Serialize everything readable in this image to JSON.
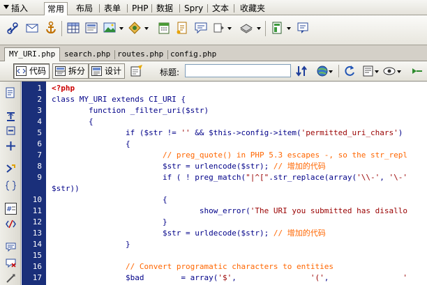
{
  "insert_bar": {
    "tabs": [
      {
        "label": "插入",
        "active": false
      },
      {
        "label": "常用",
        "active": true
      },
      {
        "label": "布局",
        "active": false
      },
      {
        "label": "表单",
        "active": false
      },
      {
        "label": "PHP",
        "active": false
      },
      {
        "label": "数据",
        "active": false
      },
      {
        "label": "Spry",
        "active": false
      },
      {
        "label": "文本",
        "active": false
      },
      {
        "label": "收藏夹",
        "active": false
      }
    ]
  },
  "icon_bar": {
    "icons": [
      "hyperlink-icon",
      "email-link-icon",
      "named-anchor-icon",
      "table-icon",
      "div-icon",
      "image-icon",
      "media-icon",
      "date-icon",
      "server-side-include-icon",
      "comment-icon",
      "head-icon",
      "script-icon",
      "templates-icon",
      "tag-chooser-icon"
    ]
  },
  "document_tabs": [
    {
      "label": "MY_URI.php",
      "active": true
    },
    {
      "label": "search.php",
      "active": false
    },
    {
      "label": "routes.php",
      "active": false
    },
    {
      "label": "config.php",
      "active": false
    }
  ],
  "doc_toolbar": {
    "code_view": "代码",
    "split_view": "拆分",
    "design_view": "设计",
    "title_label": "标题:",
    "title_value": ""
  },
  "editor": {
    "gutter_color": "#1a2f7a",
    "line_numbers": [
      "1",
      "2",
      "3",
      "4",
      "5",
      "6",
      "7",
      "8",
      "9",
      "",
      "10",
      "11",
      "12",
      "13",
      "14",
      "15",
      "16",
      "17"
    ],
    "lines": [
      "<?php",
      "class MY_URI extends CI_URI {",
      "        function _filter_uri($str)",
      "        {",
      "                if ($str != '' && $this->config->item('permitted_uri_chars')",
      "                {",
      "                        // preg_quote() in PHP 5.3 escapes -, so the str_repl",
      "                        $str = urlencode($str); // 增加的代码",
      "                        if ( ! preg_match(\"|^[\".str_replace(array('\\\\-', '\\-'",
      "$str))",
      "                        {",
      "                                show_error('The URI you submitted has disallo",
      "                        }",
      "                        $str = urldecode($str); // 增加的代码",
      "                }",
      "",
      "                // Convert programatic characters to entities",
      "                $bad        = array('$',                '(',                '"
    ]
  },
  "colors": {
    "keyword": "#000099",
    "string": "#990000",
    "comment": "#ff6600",
    "php_tag": "#cc0000"
  }
}
